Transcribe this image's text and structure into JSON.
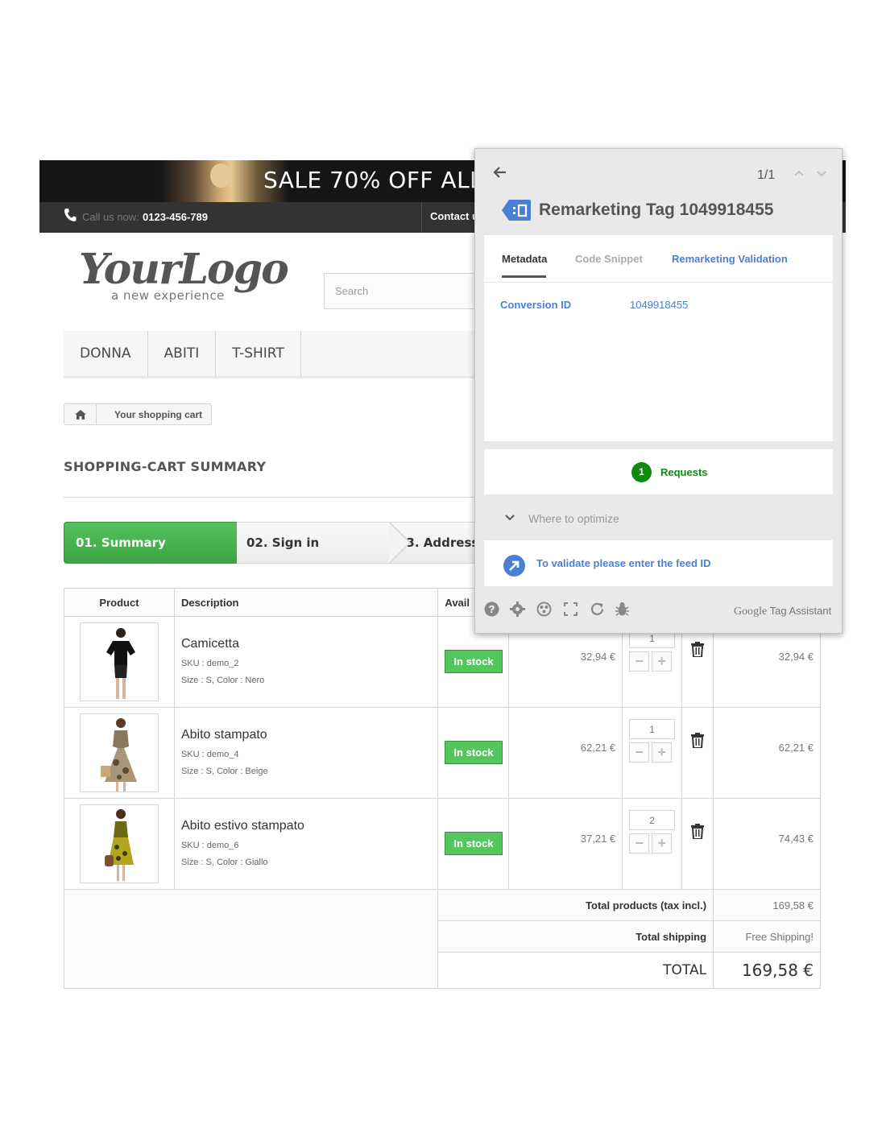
{
  "banner": {
    "text": "SALE 70% OFF ALL"
  },
  "contact_bar": {
    "call_label": "Call us now:",
    "phone": "0123-456-789",
    "contact_link": "Contact u"
  },
  "logo": {
    "main": "YourLogo",
    "tagline": "a new experience"
  },
  "search": {
    "placeholder": "Search"
  },
  "menu": {
    "items": [
      {
        "label": "DONNA"
      },
      {
        "label": "ABITI"
      },
      {
        "label": "T-SHIRT"
      }
    ]
  },
  "breadcrumb": {
    "current": "Your shopping cart"
  },
  "page": {
    "heading": "SHOPPING-CART SUMMARY"
  },
  "steps": [
    {
      "label": "01. Summary"
    },
    {
      "label": "02. Sign in"
    },
    {
      "label": "03. Address"
    }
  ],
  "cart": {
    "headers": {
      "product": "Product",
      "description": "Description",
      "availability": "Avail"
    },
    "items": [
      {
        "name": "Camicetta",
        "sku": "SKU : demo_2",
        "attrs": "Size : S, Color : Nero",
        "stock": "In stock",
        "unit_price": "32,94 €",
        "qty": "1",
        "total": "32,94 €"
      },
      {
        "name": "Abito stampato",
        "sku": "SKU : demo_4",
        "attrs": "Size : S, Color : Beige",
        "stock": "In stock",
        "unit_price": "62,21 €",
        "qty": "1",
        "total": "62,21 €"
      },
      {
        "name": "Abito estivo stampato",
        "sku": "SKU : demo_6",
        "attrs": "Size : S, Color : Giallo",
        "stock": "In stock",
        "unit_price": "37,21 €",
        "qty": "2",
        "total": "74,43 €"
      }
    ],
    "summary": {
      "products_label": "Total products (tax incl.)",
      "products_value": "169,58 €",
      "shipping_label": "Total shipping",
      "shipping_value": "Free Shipping!",
      "total_label": "TOTAL",
      "total_value": "169,58 €"
    }
  },
  "tag_assistant": {
    "counter": "1/1",
    "title": "Remarketing Tag 1049918455",
    "tabs": {
      "metadata": "Metadata",
      "code": "Code Snippet",
      "validation": "Remarketing Validation"
    },
    "metadata": {
      "key": "Conversion ID",
      "value": "1049918455"
    },
    "requests": {
      "count": "1",
      "label": "Requests"
    },
    "optimize": {
      "label": "Where to optimize"
    },
    "validate": {
      "label": "To validate please enter the feed ID"
    },
    "brand": {
      "google": "Google",
      "product": "Tag Assistant"
    },
    "colors": {
      "link": "#4a7fd6",
      "success": "#0f8a0f"
    }
  },
  "colors": {
    "step_active": "#46b04c",
    "in_stock": "#55c65e"
  }
}
